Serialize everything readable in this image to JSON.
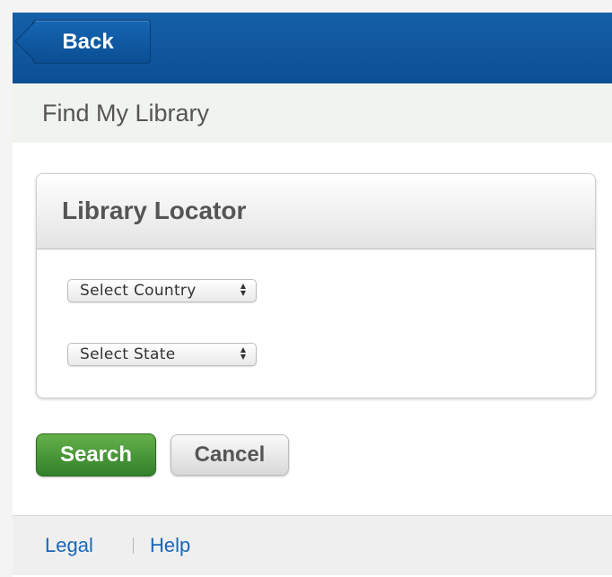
{
  "header": {
    "back_label": "Back"
  },
  "page": {
    "title": "Find My Library"
  },
  "panel": {
    "title": "Library Locator",
    "country_select": {
      "selected": "Select Country"
    },
    "state_select": {
      "selected": "Select State"
    }
  },
  "actions": {
    "search_label": "Search",
    "cancel_label": "Cancel"
  },
  "footer": {
    "links": [
      {
        "label": "Legal"
      },
      {
        "label": "Help"
      }
    ]
  },
  "colors": {
    "header_blue": "#0d4f95",
    "search_green": "#32802a",
    "link_blue": "#1a66b8"
  },
  "icons": {
    "select_arrow": "up-down-chevron-icon"
  }
}
